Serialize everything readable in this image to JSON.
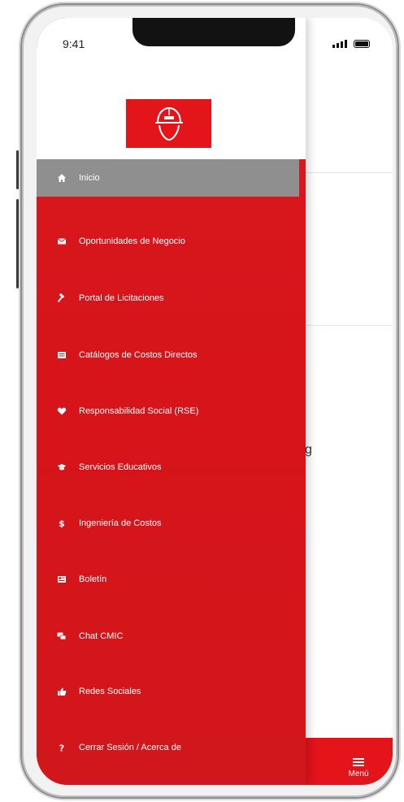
{
  "status_bar": {
    "time": "9:41"
  },
  "background_app": {
    "partial_text": "g"
  },
  "bottom_bar": {
    "menu_label": "Menú"
  },
  "drawer": {
    "items": [
      {
        "label": "Inicio",
        "icon": "home-icon",
        "active": true
      },
      {
        "label": "Oportunidades de Negocio",
        "icon": "envelope-icon"
      },
      {
        "label": "Portal de Licitaciones",
        "icon": "gavel-icon"
      },
      {
        "label": "Catálogos de Costos Directos",
        "icon": "catalog-icon"
      },
      {
        "label": "Responsabilidad Social (RSE)",
        "icon": "heart-icon"
      },
      {
        "label": "Servicios Educativos",
        "icon": "graduation-cap-icon"
      },
      {
        "label": "Ingeniería de Costos",
        "icon": "dollar-icon"
      },
      {
        "label": "Boletín",
        "icon": "newspaper-icon"
      },
      {
        "label": "Chat CMIC",
        "icon": "chat-icon"
      },
      {
        "label": "Redes Sociales",
        "icon": "thumbs-up-icon"
      },
      {
        "label": "Cerrar Sesión / Acerca de",
        "icon": "question-icon"
      }
    ]
  },
  "colors": {
    "brand_red": "#e3141a",
    "active_item": "#8f8f8f"
  }
}
